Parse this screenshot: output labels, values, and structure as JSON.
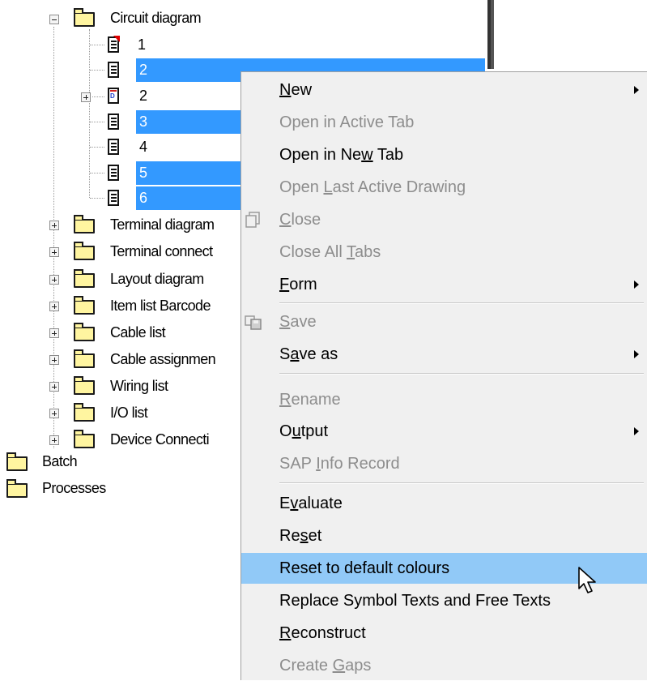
{
  "tree": {
    "circuit_folder": "Circuit diagram",
    "pages": [
      {
        "label": "1",
        "selected": false
      },
      {
        "label": "2",
        "selected": true
      },
      {
        "label": "2",
        "selected": false
      },
      {
        "label": "3",
        "selected": true
      },
      {
        "label": "4",
        "selected": false
      },
      {
        "label": "5",
        "selected": true
      },
      {
        "label": "6",
        "selected": true
      }
    ],
    "folders": [
      "Terminal diagram",
      "Terminal connect",
      "Layout diagram",
      "Item list Barcode",
      "Cable list",
      "Cable assignmen",
      "Wiring list",
      "I/O list",
      "Device Connecti"
    ],
    "root_folders": [
      "Batch",
      "Processes"
    ]
  },
  "menu": {
    "items": [
      {
        "label": "New",
        "mnemonic": "N",
        "disabled": false,
        "submenu": true
      },
      {
        "label": "Open in Active Tab",
        "disabled": true
      },
      {
        "label": "Open in New Tab",
        "mnemonic": "w",
        "disabled": false
      },
      {
        "label": "Open Last Active Drawing",
        "mnemonic": "L",
        "disabled": true
      },
      {
        "label": "Close",
        "mnemonic": "C",
        "disabled": true,
        "icon": "close-drawing-icon"
      },
      {
        "label": "Close All Tabs",
        "mnemonic": "T",
        "disabled": true
      },
      {
        "label": "Form",
        "mnemonic": "F",
        "disabled": false,
        "submenu": true
      },
      {
        "label": "Save",
        "mnemonic": "S",
        "disabled": true,
        "icon": "save-icon"
      },
      {
        "label": "Save as",
        "mnemonic": "a",
        "disabled": false,
        "submenu": true
      },
      {
        "label": "Rename",
        "mnemonic": "R",
        "disabled": true
      },
      {
        "label": "Output",
        "mnemonic": "u",
        "disabled": false,
        "submenu": true
      },
      {
        "label": "SAP Info Record",
        "mnemonic": "I",
        "disabled": true
      },
      {
        "label": "Evaluate",
        "mnemonic": "v",
        "disabled": false
      },
      {
        "label": "Reset",
        "mnemonic": "s",
        "disabled": false
      },
      {
        "label": "Reset to default colours",
        "disabled": false,
        "highlighted": true
      },
      {
        "label": "Replace Symbol Texts and Free Texts",
        "disabled": false
      },
      {
        "label": "Reconstruct",
        "mnemonic": "R",
        "disabled": false
      },
      {
        "label": "Create Gaps",
        "mnemonic": "G",
        "disabled": true
      }
    ]
  },
  "colors": {
    "selection": "#3399ff",
    "menu_highlight": "#91c9f7",
    "menu_background": "#f0f0f0",
    "disabled_text": "#8d8d8d",
    "folder_fill": "#fff5a0"
  }
}
